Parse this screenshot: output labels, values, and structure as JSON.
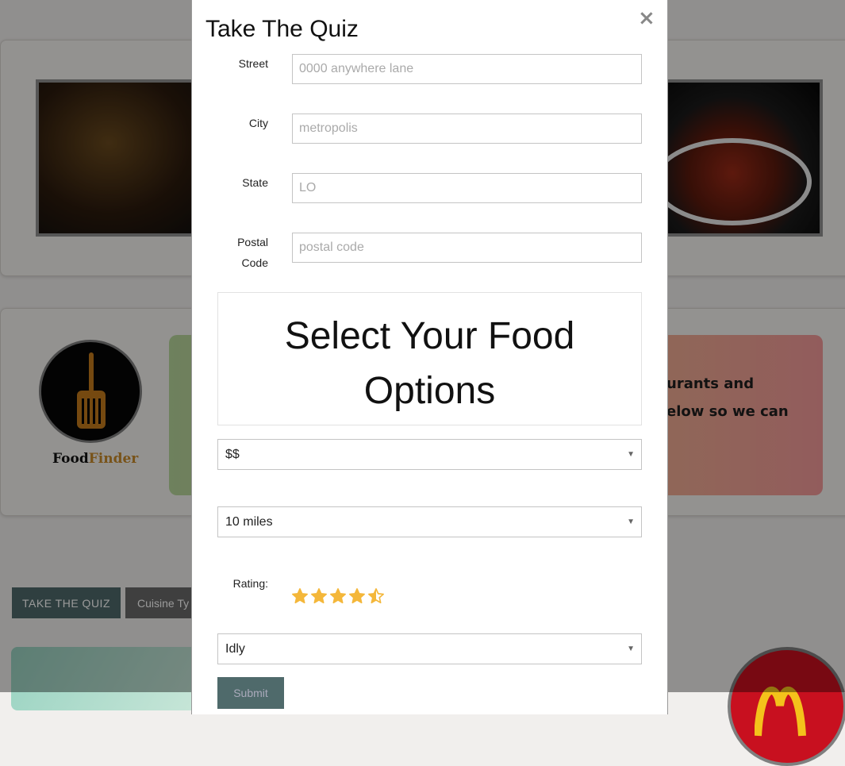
{
  "background": {
    "logo": {
      "part1": "Food",
      "part2": "Finder"
    },
    "promo_lines": [
      "urants and",
      "elow so we can"
    ],
    "tabs": {
      "quiz": "TAKE THE QUIZ",
      "cuisine": "Cuisine Ty"
    }
  },
  "modal": {
    "title": "Take The Quiz",
    "close_symbol": "×",
    "fields": {
      "street": {
        "label": "Street",
        "placeholder": "0000 anywhere lane"
      },
      "city": {
        "label": "City",
        "placeholder": "metropolis"
      },
      "state": {
        "label": "State",
        "placeholder": "LO"
      },
      "postal": {
        "label_line1": "Postal",
        "label_line2": "Code",
        "placeholder": "postal code"
      }
    },
    "food_options_title": "Select Your Food Options",
    "price_select": "$$",
    "distance_select": "10 miles",
    "rating": {
      "label": "Rating:",
      "value": 4.5,
      "max": 5,
      "color": "#f4b73a"
    },
    "food_select": "Idly",
    "submit_label": "Submit"
  }
}
